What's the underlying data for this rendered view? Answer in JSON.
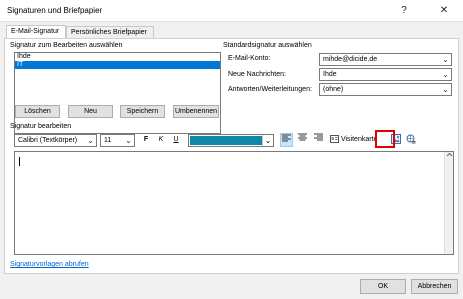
{
  "window": {
    "title": "Signaturen und Briefpapier",
    "help": "?",
    "close": "✕"
  },
  "tabs": [
    {
      "label": "E-Mail-Signatur"
    },
    {
      "label": "Persönliches Briefpapier"
    }
  ],
  "signature_list": {
    "label": "Signatur zum Bearbeiten auswählen",
    "items": [
      {
        "label": "Ihde"
      },
      {
        "label": "IT"
      }
    ],
    "selected_index": 1
  },
  "list_buttons": {
    "delete": "Löschen",
    "new": "Neu",
    "save": "Speichern",
    "rename": "Umbenennen"
  },
  "defaults": {
    "label": "Standardsignatur auswählen",
    "account_label": "E-Mail-Konto:",
    "account_value": "mihde@dicide.de",
    "new_messages_label": "Neue Nachrichten:",
    "new_messages_value": "Ihde",
    "replies_label": "Antworten/Weiterleitungen:",
    "replies_value": "(ohne)"
  },
  "editor": {
    "label": "Signatur bearbeiten",
    "font": "Calibri (Textkörper)",
    "size": "11",
    "bold": "F",
    "italic": "K",
    "underline": "U",
    "font_color": "#0e87a8",
    "business_card": "Visitenkarte"
  },
  "link": "Signaturvorlagen abrufen",
  "footer": {
    "ok": "OK",
    "cancel": "Abbrechen"
  }
}
